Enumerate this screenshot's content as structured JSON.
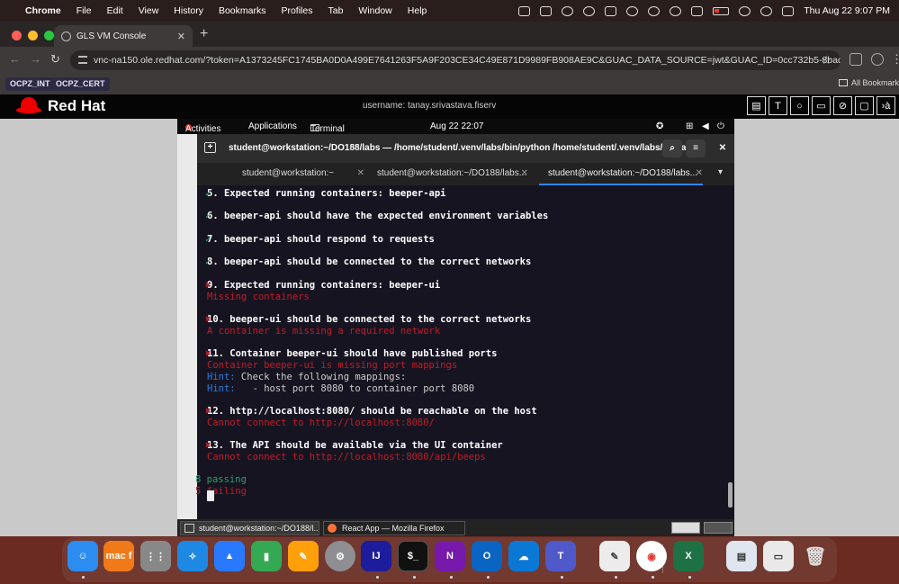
{
  "menubar": {
    "app_name": "Chrome",
    "items": [
      "File",
      "Edit",
      "View",
      "History",
      "Bookmarks",
      "Profiles",
      "Tab",
      "Window",
      "Help"
    ],
    "clock": "Thu Aug 22  9:07 PM"
  },
  "browser": {
    "tab_title": "GLS VM Console",
    "url": "vnc-na150.ole.redhat.com/?token=A1373245FC1745BA0D0A499E7641263F5A9F203CE34C49E871D9989FB908AE9C&GUAC_DATA_SOURCE=jwt&GUAC_ID=0cc732b5-8bad-454...",
    "bookmarks": [
      "OCPZ_INT",
      "OCPZ_CERT"
    ],
    "all_bookmarks": "All Bookmark"
  },
  "console": {
    "brand": "Red Hat",
    "username": "username: tanay.srivastava.fiserv",
    "toolbar_icons": [
      "T",
      "›à"
    ]
  },
  "gnome": {
    "activities": "Activities",
    "applications": "Applications",
    "terminal": "Terminal",
    "datetime": "Aug 22  22:07"
  },
  "terminal": {
    "title": "student@workstation:~/DO188/labs — /home/student/.venv/labs/bin/python /home/student/.venv/labs/bin/lab ...",
    "tabs": [
      "student@workstation:~",
      "student@workstation:~/DO188/labs...",
      "student@workstation:~/DO188/labs..."
    ],
    "lines": {
      "l5": "5. Expected running containers: beeper-api",
      "l6": "6. beeper-api should have the expected environment variables",
      "l7": "7. beeper-api should respond to requests",
      "l8": "8. beeper-api should be connected to the correct networks",
      "l9": "9. Expected running containers: beeper-ui",
      "l9e": "Missing containers",
      "l10": "10. beeper-ui should be connected to the correct networks",
      "l10e": "A container is missing a required network",
      "l11": "11. Container beeper-ui should have published ports",
      "l11e": "Container beeper-ui is missing port mappings",
      "hint_label": "Hint:",
      "hint1": " Check the following mappings:",
      "hint2": "   - host port 8080 to container port 8080",
      "l12": "12. http://localhost:8080/ should be reachable on the host",
      "l12e": "Cannot connect to http://localhost:8080/",
      "l13": "13. The API should be available via the UI container",
      "l13e": "Cannot connect to http://localhost:8080/api/beeps",
      "passing": "8 passing",
      "failing": "5 failing"
    },
    "check_mark": "✓",
    "cross_mark": "✖"
  },
  "taskbar": {
    "items": [
      "student@workstation:~/DO188/l...",
      "React App — Mozilla Firefox"
    ]
  },
  "dock": {
    "icons": [
      "finder-icon",
      "macf-icon",
      "launchpad-icon",
      "safari-icon",
      "keynote-icon",
      "numbers-icon",
      "pages-icon",
      "system-settings-icon",
      "intellij-icon",
      "terminal-icon",
      "onenote-icon",
      "outlook-icon",
      "onedrive-icon",
      "teams-icon",
      "textedit-icon",
      "chrome-icon",
      "excel-icon",
      "preview-icon",
      "chrome-apps-icon",
      "trash-icon"
    ],
    "labels": {
      "macf": "mac f",
      "intellij": "IJ",
      "terminal": "$_",
      "onenote": "N",
      "outlook": "O",
      "teams": "T",
      "excel": "X"
    }
  },
  "colors": {
    "pass": "#26a269",
    "fail": "#c01c28",
    "hint": "#2a7bde",
    "terminal_bg": "#171421"
  }
}
